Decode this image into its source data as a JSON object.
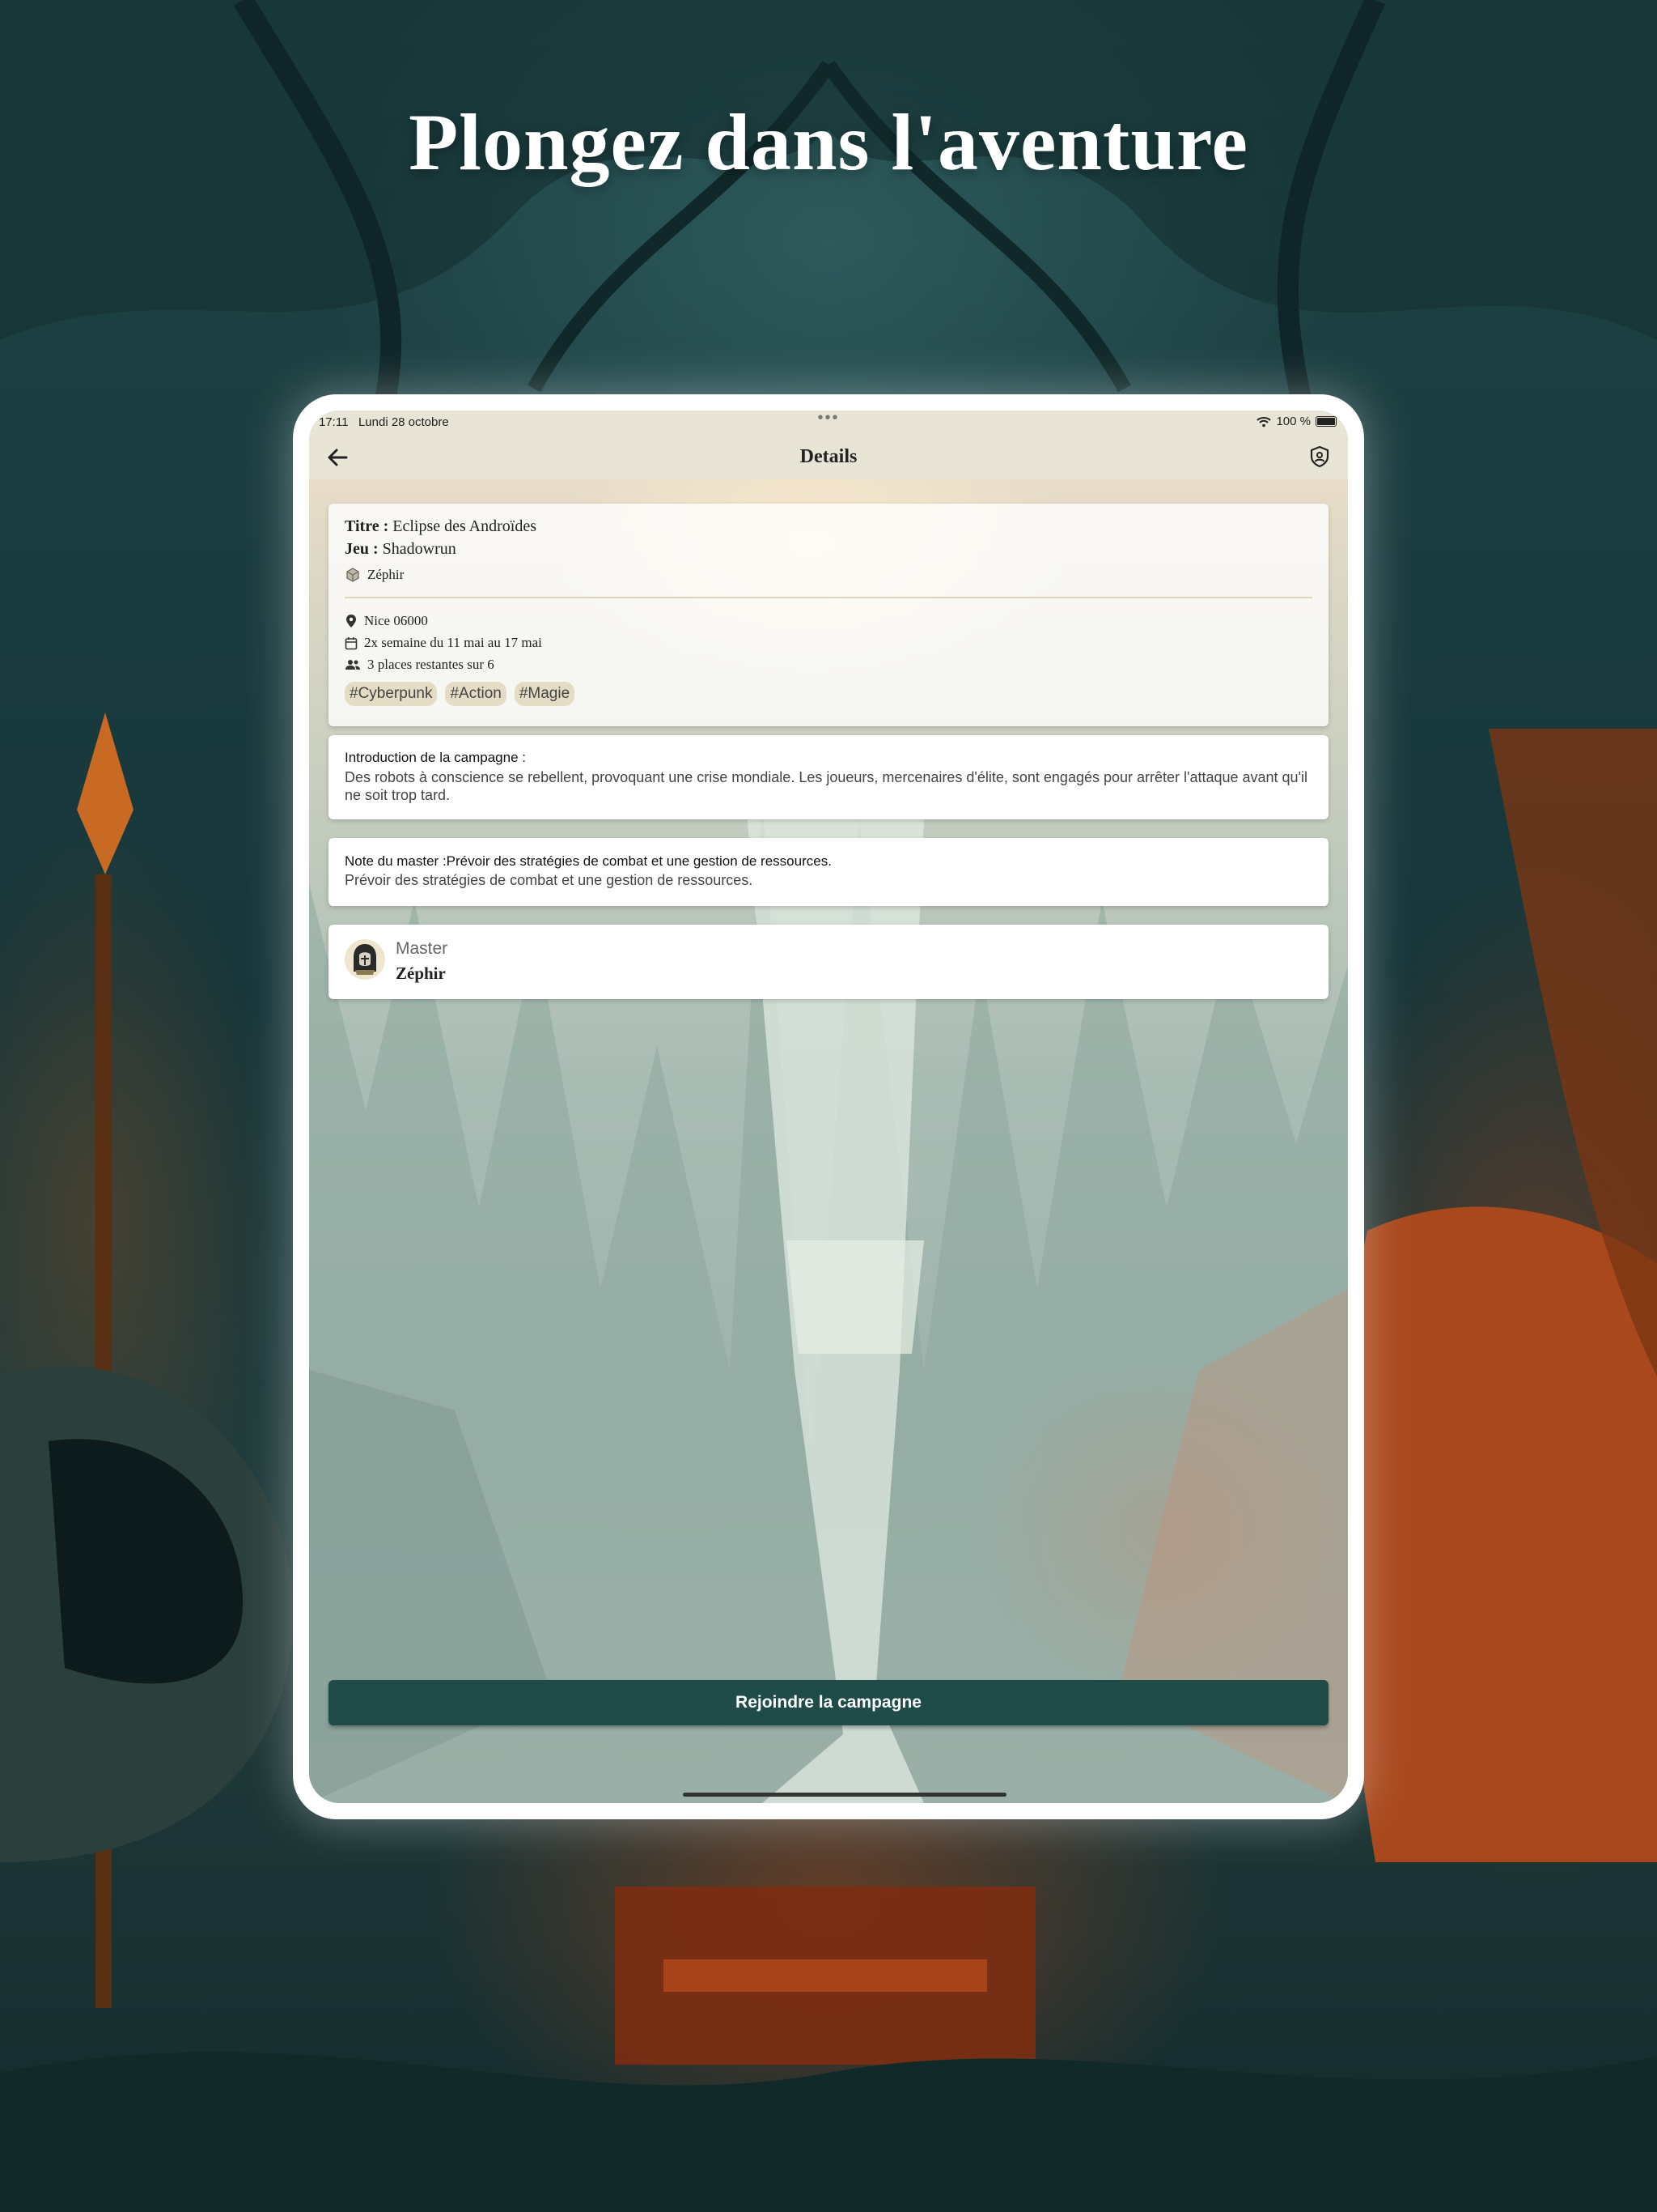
{
  "headline": "Plongez dans l'aventure",
  "status_bar": {
    "time": "17:11",
    "date": "Lundi 28 octobre",
    "dots": "•••",
    "battery": "100 %"
  },
  "nav": {
    "title": "Details"
  },
  "campaign": {
    "title_label": "Titre :",
    "title_value": "Eclipse des Androïdes",
    "game_label": "Jeu :",
    "game_value": "Shadowrun",
    "author": "Zéphir",
    "location": "Nice 06000",
    "schedule": "2x semaine du 11 mai au 17 mai",
    "places": "3 places restantes sur 6",
    "tags": [
      "#Cyberpunk",
      "#Action",
      "#Magie"
    ]
  },
  "intro": {
    "label": "Introduction de la campagne :",
    "text": "Des robots à conscience se rebellent, provoquant une crise mondiale. Les joueurs, mercenaires d'élite, sont engagés pour arrêter l'attaque avant qu'il ne soit trop tard."
  },
  "note": {
    "label": "Note du master :Prévoir des stratégies de combat et une gestion de ressources.",
    "text": "Prévoir des stratégies de combat et une gestion de ressources."
  },
  "master": {
    "label": "Master",
    "name": "Zéphir"
  },
  "join_button": "Rejoindre la campagne",
  "icons": {
    "back": "arrow-left-icon",
    "shield": "shield-person-icon",
    "wifi": "wifi-icon",
    "battery": "battery-icon",
    "dice": "dice-icon",
    "pin": "map-pin-icon",
    "calendar": "calendar-icon",
    "people": "people-icon"
  },
  "colors": {
    "accent": "#1f4b49",
    "nav_bg": "#e8e4d6",
    "tag_bg": "#e5dcc6"
  }
}
